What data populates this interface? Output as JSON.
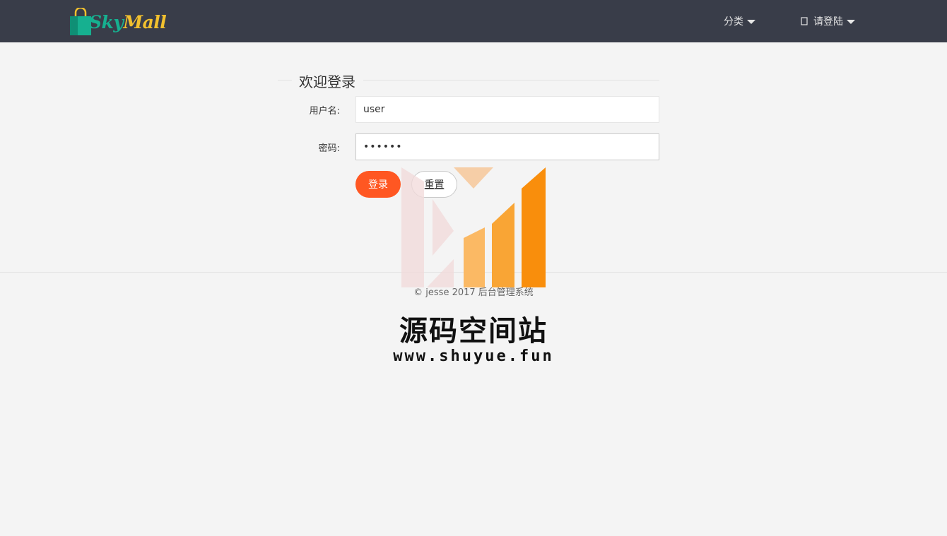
{
  "header": {
    "logo": {
      "part1": "Sky",
      "part2": "Mall"
    },
    "nav": {
      "category_label": "分类",
      "login_label": "请登陆"
    }
  },
  "login_form": {
    "legend": "欢迎登录",
    "username": {
      "label": "用户名:",
      "value": "user"
    },
    "password": {
      "label": "密码:",
      "value": "••••••"
    },
    "login_button": "登录",
    "reset_button": "重置"
  },
  "footer": {
    "text": "© jesse 2017 后台管理系统"
  },
  "watermark": {
    "title": "源码空间站",
    "url": "www.shuyue.fun"
  },
  "colors": {
    "header_bg": "#393d49",
    "accent": "#ff5722",
    "logo_teal": "#16b090",
    "logo_yellow": "#f2c12e"
  }
}
